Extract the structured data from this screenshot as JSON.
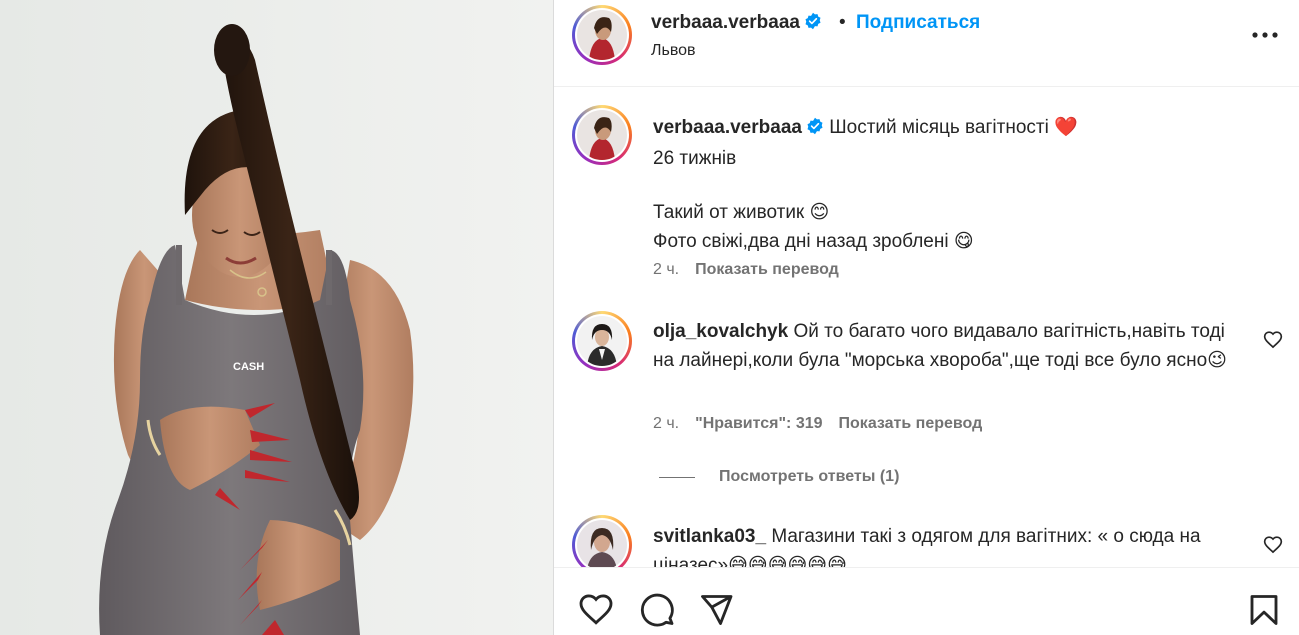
{
  "post": {
    "username": "verbaaa.verbaaa",
    "dot": "•",
    "follow_label": "Подписаться",
    "location": "Львов",
    "more_icon": "more-horizontal-icon"
  },
  "caption": {
    "username": "verbaaa.verbaaa",
    "line1": "Шостий місяць вагітності ❤️",
    "line2": "26 тижнів",
    "line3": "Такий от животик 😊",
    "line4": "Фото свіжі,два дні назад зроблені 😋",
    "time": "2 ч.",
    "translate_label": "Показать перевод"
  },
  "comments": [
    {
      "username": "olja_kovalchyk",
      "text": "Ой то багато чого видавало вагітність,навіть тоді на лайнері,коли була \"морська хвороба\",ще тоді все було ясно😉",
      "time": "2 ч.",
      "likes": "\"Нравится\": 319",
      "translate_label": "Показать перевод"
    },
    {
      "username": "svitlanka03_",
      "text": "Магазини такі з одягом для вагітних: « о сюда на ціназес»😅😅😅😅😅😅"
    }
  ],
  "view_replies_label": "Посмотреть ответы (1)",
  "actions": {
    "like_icon": "heart-icon",
    "comment_icon": "comment-icon",
    "share_icon": "send-icon",
    "save_icon": "bookmark-icon"
  },
  "colors": {
    "accent": "#0095f6",
    "verified": "#0095f6",
    "secondary_text": "#737373"
  }
}
